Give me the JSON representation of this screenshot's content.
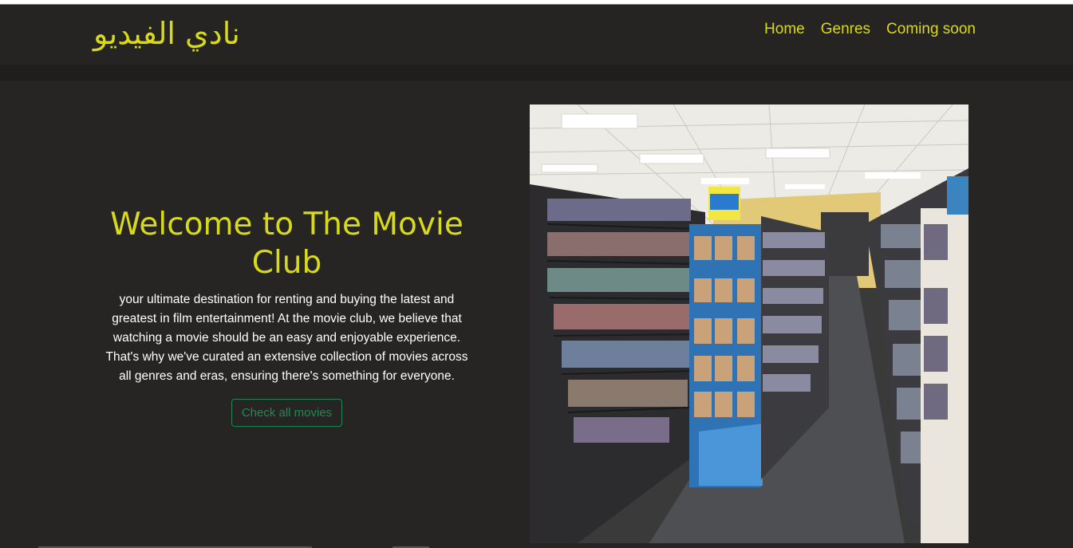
{
  "header": {
    "brand": "نادي الفيديو",
    "nav": [
      {
        "label": "Home"
      },
      {
        "label": "Genres"
      },
      {
        "label": "Coming soon"
      }
    ]
  },
  "hero": {
    "title": "Welcome to The Movie Club",
    "description": "your ultimate destination for renting and buying the latest and greatest in film entertainment! At the movie club, we believe that watching a movie should be an easy and enjoyable experience. That's why we've curated an extensive collection of movies across all genres and eras, ensuring there's something for everyone.",
    "button_label": "Check all movies"
  },
  "colors": {
    "accent": "#d8d918",
    "background": "#262523",
    "button_border": "#198754"
  }
}
